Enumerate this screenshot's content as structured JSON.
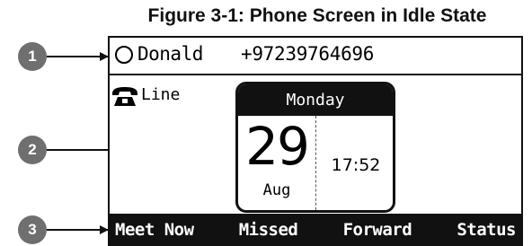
{
  "figure": {
    "title": "Figure 3-1: Phone Screen in Idle State"
  },
  "callouts": [
    "1",
    "2",
    "3"
  ],
  "screen": {
    "status": {
      "icon": "presence-circle-icon",
      "user": "Donald",
      "number": "+97239764696"
    },
    "line": {
      "icon": "phone-icon",
      "label": "Line"
    },
    "calendar": {
      "day": "Monday",
      "date": "29",
      "month": "Aug",
      "time": "17:52"
    },
    "softkeys": [
      "Meet Now",
      "Missed",
      "Forward",
      "Status"
    ]
  },
  "colors": {
    "callout": "#6f6f6f",
    "screen_border": "#111111",
    "softkey_bar": "#111111"
  }
}
